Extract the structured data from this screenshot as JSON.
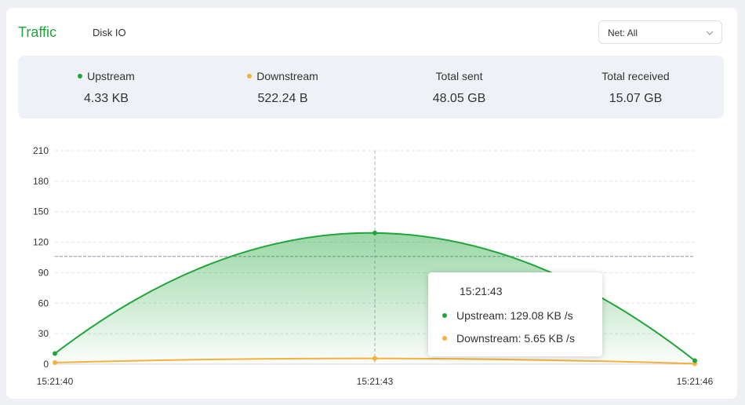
{
  "tabs": [
    {
      "label": "Traffic",
      "active": true
    },
    {
      "label": "Disk IO",
      "active": false
    }
  ],
  "net_select": {
    "value": "Net: All",
    "icon": "chevron-down-icon"
  },
  "stats": [
    {
      "label": "Upstream",
      "value": "4.33 KB",
      "dot_color": "#20a53a"
    },
    {
      "label": "Downstream",
      "value": "522.24 B",
      "dot_color": "#f7b03b"
    },
    {
      "label": "Total sent",
      "value": "48.05 GB"
    },
    {
      "label": "Total received",
      "value": "15.07 GB"
    }
  ],
  "tooltip": {
    "title": "15:21:43",
    "rows": [
      {
        "text": "Upstream: 129.08 KB /s",
        "color": "#20a53a"
      },
      {
        "text": "Downstream: 5.65 KB /s",
        "color": "#f7b03b"
      }
    ]
  },
  "colors": {
    "upstream": "#20a53a",
    "downstream": "#f7b03b",
    "accent": "#20a53a"
  },
  "chart_data": {
    "type": "area",
    "categories": [
      "15:21:40",
      "15:21:43",
      "15:21:46"
    ],
    "y_ticks": [
      "0",
      "30",
      "60",
      "90",
      "120",
      "150",
      "180",
      "210"
    ],
    "ylim": [
      0,
      210
    ],
    "grid": true,
    "series": [
      {
        "name": "Upstream",
        "values": [
          10.5,
          129.08,
          3.5
        ],
        "color": "#20a53a",
        "fill": true
      },
      {
        "name": "Downstream",
        "values": [
          1.5,
          5.65,
          0.5
        ],
        "color": "#f7b03b",
        "fill": false
      }
    ],
    "crosshair_x": "15:21:43",
    "crosshair_y": 106
  }
}
